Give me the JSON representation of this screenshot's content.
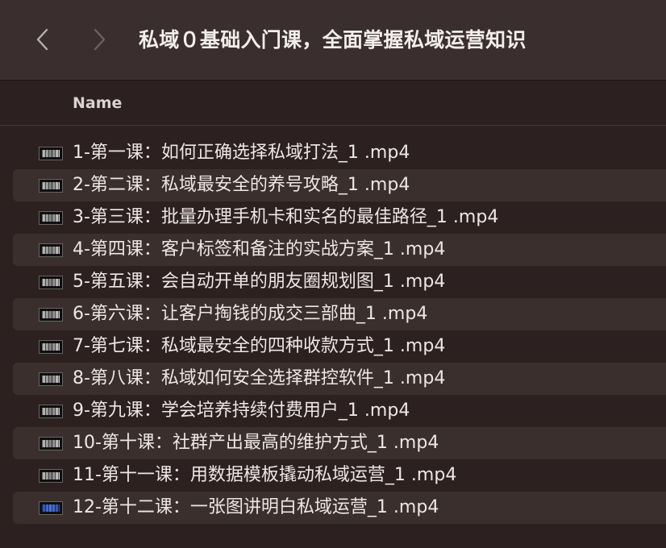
{
  "window": {
    "title": "私域０基础入门课，全面掌握私域运营知识"
  },
  "nav": {
    "back_icon": "chevron-left",
    "forward_icon": "chevron-right"
  },
  "columns": {
    "name": "Name"
  },
  "files": [
    {
      "name": "1-第一课：如何正确选择私域打法_1 .mp4",
      "thumb": "gray"
    },
    {
      "name": "2-第二课：私域最安全的养号攻略_1 .mp4",
      "thumb": "gray"
    },
    {
      "name": "3-第三课：批量办理手机卡和实名的最佳路径_1 .mp4",
      "thumb": "gray"
    },
    {
      "name": "4-第四课：客户标签和备注的实战方案_1 .mp4",
      "thumb": "gray"
    },
    {
      "name": "5-第五课：会自动开单的朋友圈规划图_1 .mp4",
      "thumb": "gray"
    },
    {
      "name": "6-第六课：让客户掏钱的成交三部曲_1 .mp4",
      "thumb": "gray"
    },
    {
      "name": "7-第七课：私域最安全的四种收款方式_1 .mp4",
      "thumb": "gray"
    },
    {
      "name": "8-第八课：私域如何安全选择群控软件_1 .mp4",
      "thumb": "gray"
    },
    {
      "name": "9-第九课：学会培养持续付费用户_1 .mp4",
      "thumb": "gray"
    },
    {
      "name": "10-第十课：社群产出最高的维护方式_1 .mp4",
      "thumb": "gray"
    },
    {
      "name": "11-第十一课：用数据模板撬动私域运营_1 .mp4",
      "thumb": "gray"
    },
    {
      "name": "12-第十二课：一张图讲明白私域运营_1 .mp4",
      "thumb": "blue"
    }
  ],
  "colors": {
    "background": "#2d2020",
    "titlebar": "#3a2f2e",
    "alt_row": "#3b2f2e",
    "text": "#ece7e5"
  }
}
